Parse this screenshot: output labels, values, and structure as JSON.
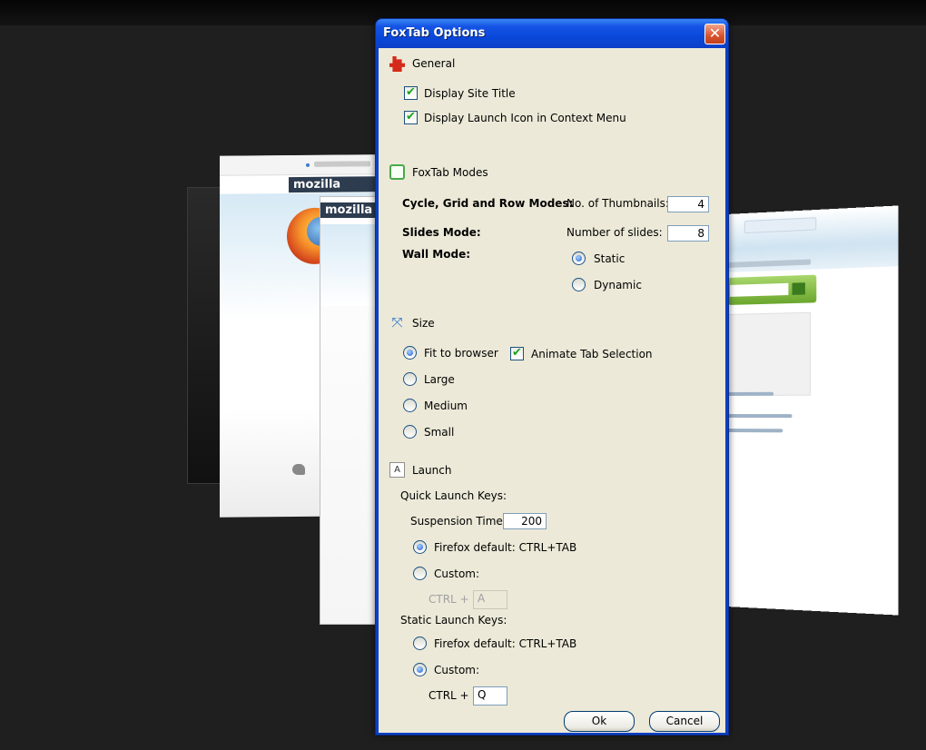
{
  "window": {
    "title": "FoxTab Options",
    "close_label": "✕"
  },
  "background": {
    "thumb1_label": "mozilla",
    "thumb2_label": "mozilla"
  },
  "general": {
    "label": "General",
    "display_site_title": {
      "label": "Display Site Title",
      "checked": true
    },
    "display_launch_icon": {
      "label": "Display Launch Icon in Context Menu",
      "checked": true
    }
  },
  "modes": {
    "label": "FoxTab Modes",
    "cycle_grid_row": {
      "label": "Cycle, Grid and Row Modes:",
      "field_label": "No. of Thumbnails:",
      "value": "4"
    },
    "slides": {
      "label": "Slides Mode:",
      "field_label": "Number of slides:",
      "value": "8"
    },
    "wall": {
      "label": "Wall Mode:",
      "options": [
        "Static",
        "Dynamic"
      ],
      "selected": "Static"
    }
  },
  "size": {
    "label": "Size",
    "options": [
      "Fit to browser",
      "Large",
      "Medium",
      "Small"
    ],
    "selected": "Fit to browser",
    "animate_tab_selection": {
      "label": "Animate Tab Selection",
      "checked": true
    }
  },
  "launch": {
    "label": "Launch",
    "quick": {
      "label": "Quick Launch Keys:",
      "suspension_label": "Suspension Time:",
      "suspension_value": "200",
      "default_option": "Firefox default: CTRL+TAB",
      "custom_option": "Custom:",
      "selected": "default",
      "ctrl_label": "CTRL +",
      "key_value": "A"
    },
    "static": {
      "label": "Static Launch Keys:",
      "default_option": "Firefox default: CTRL+TAB",
      "custom_option": "Custom:",
      "selected": "custom",
      "ctrl_label": "CTRL +",
      "key_value": "Q"
    }
  },
  "buttons": {
    "ok": "Ok",
    "cancel": "Cancel"
  },
  "colors": {
    "titlebar": "#0b3fc6",
    "client_bg": "#ece9d8",
    "close_red": "#d7522c",
    "check_green": "#21a121"
  }
}
